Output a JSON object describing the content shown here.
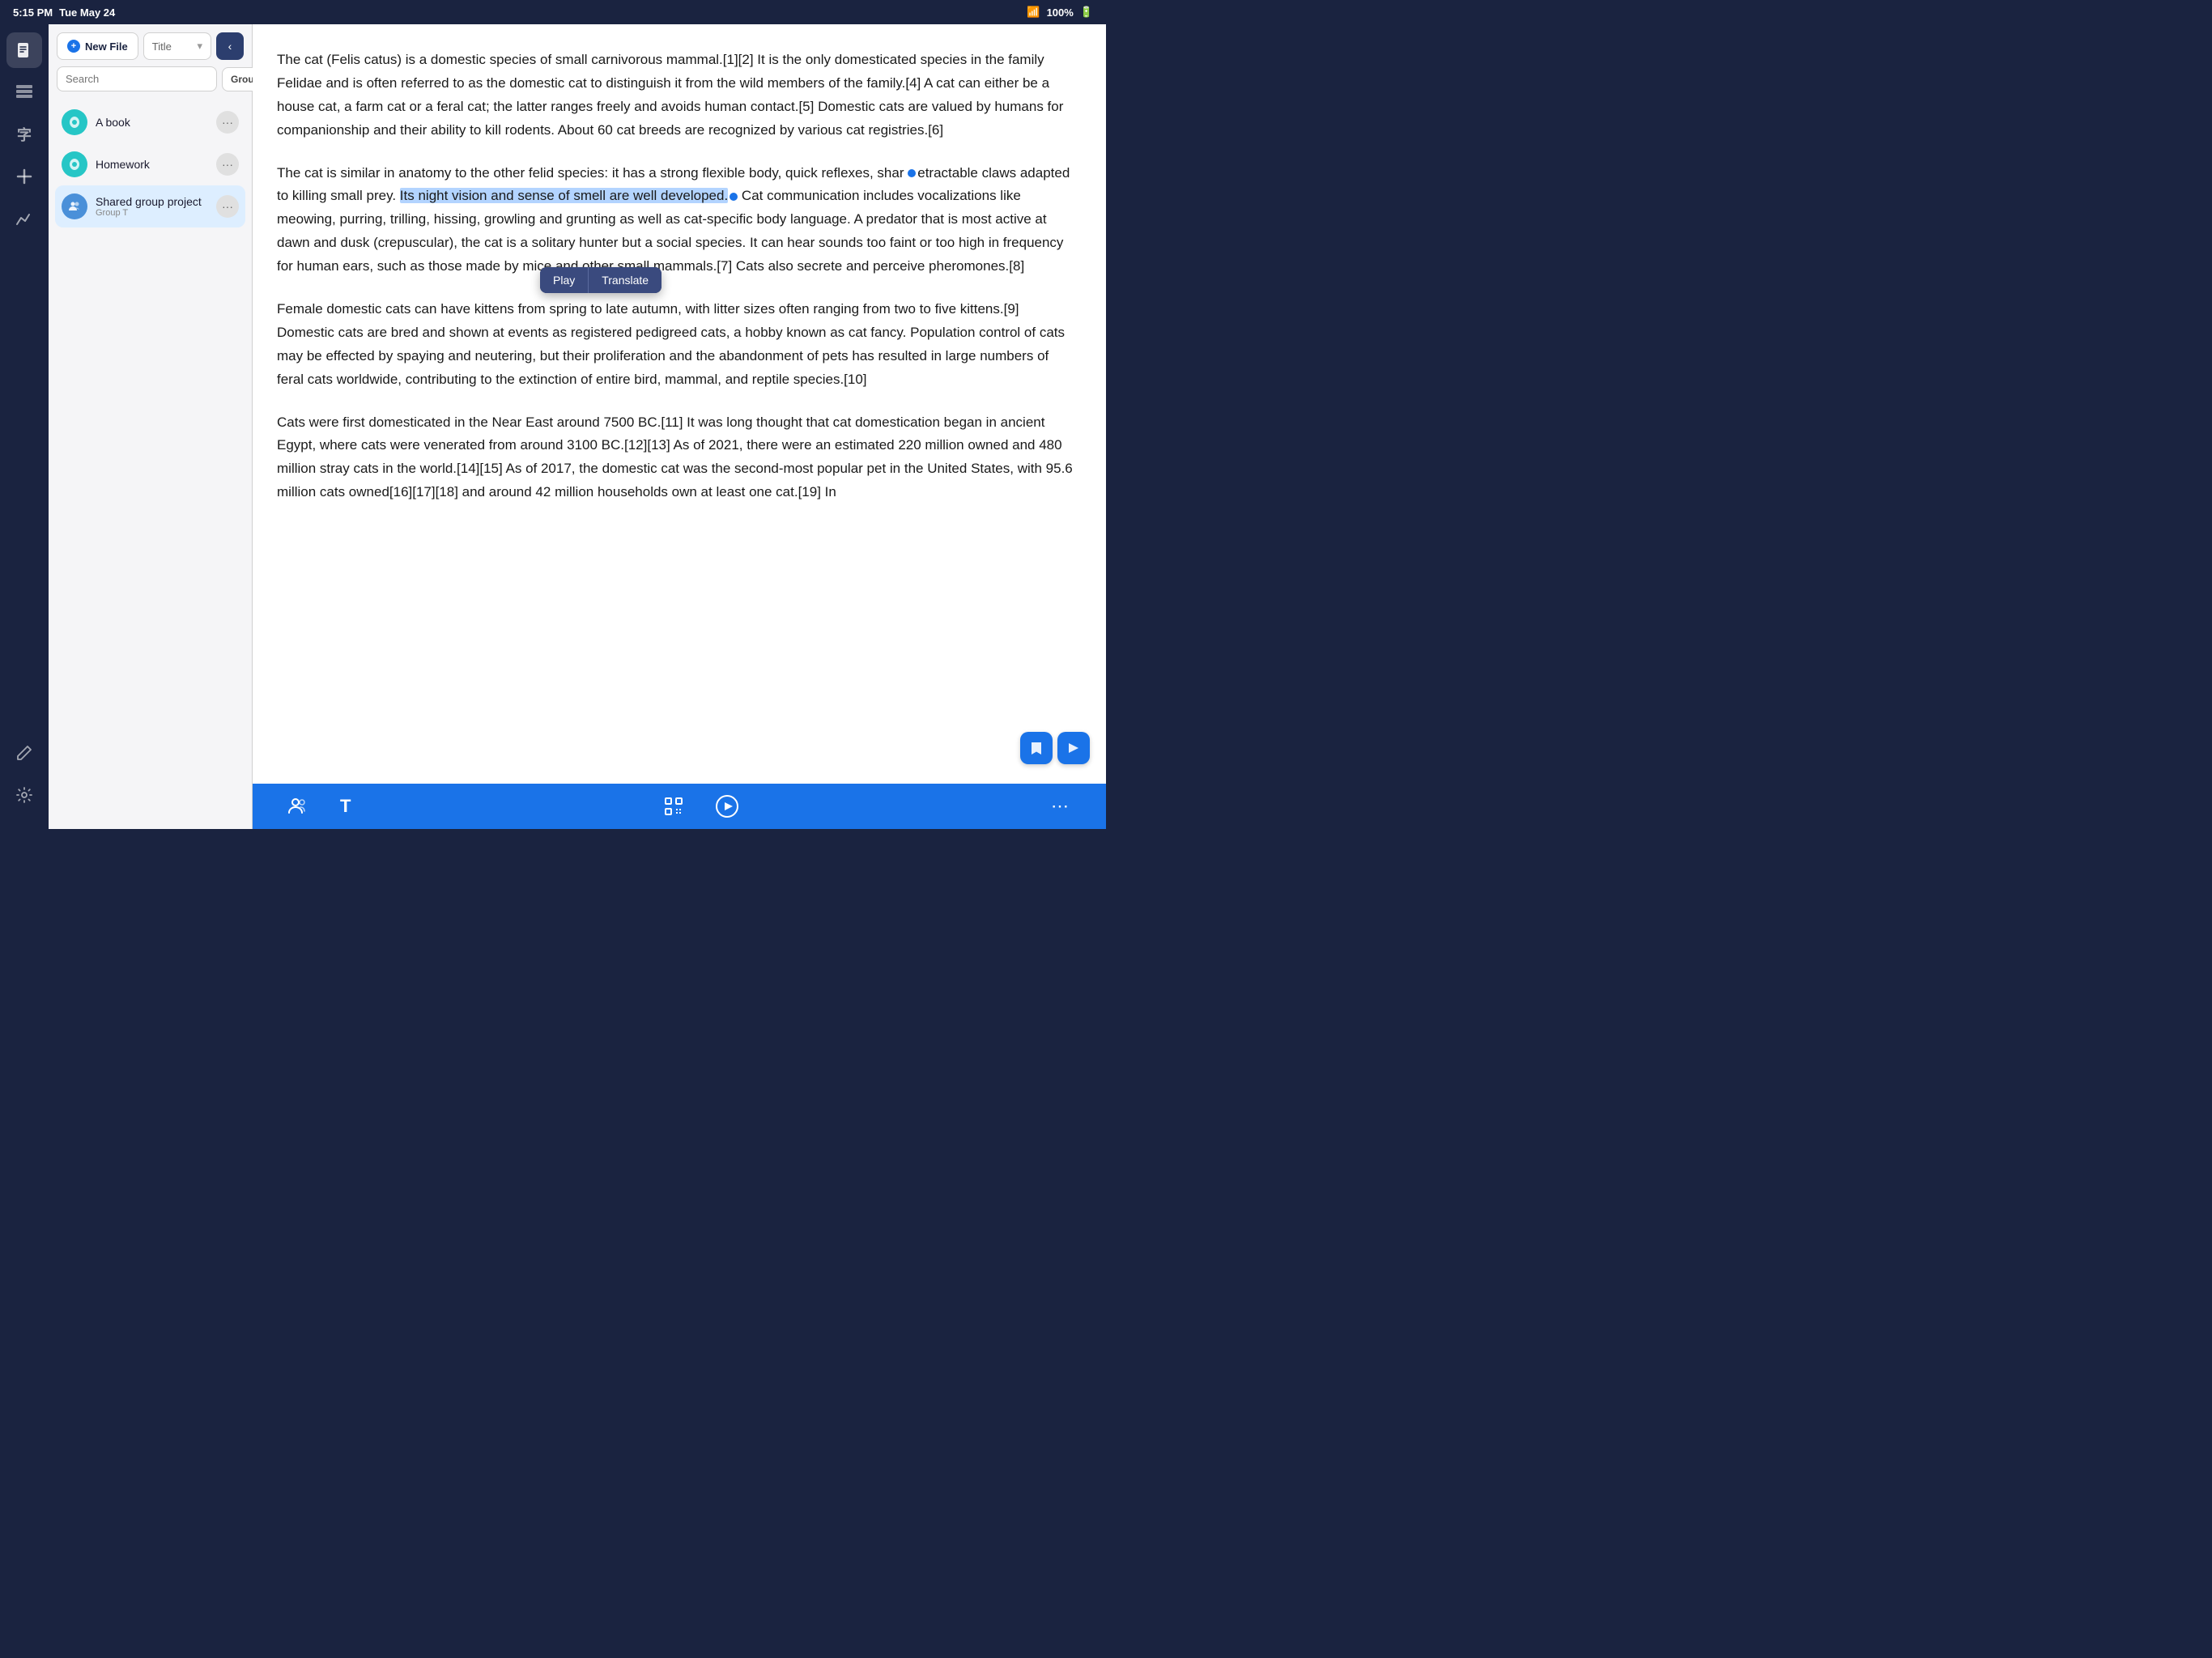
{
  "statusBar": {
    "time": "5:15 PM",
    "date": "Tue May 24",
    "battery": "100%",
    "wifi": "WiFi"
  },
  "nav": {
    "icons": [
      {
        "name": "document-icon",
        "symbol": "📄",
        "active": true
      },
      {
        "name": "bookmark-icon",
        "symbol": "🔖",
        "active": false
      },
      {
        "name": "translate-icon",
        "symbol": "字",
        "active": false
      },
      {
        "name": "add-icon",
        "symbol": "+",
        "active": false
      },
      {
        "name": "chart-icon",
        "symbol": "📈",
        "active": false
      }
    ],
    "bottomIcons": [
      {
        "name": "pen-icon",
        "symbol": "✏️"
      },
      {
        "name": "settings-icon",
        "symbol": "⚙️"
      }
    ]
  },
  "filePanel": {
    "newFileLabel": "New File",
    "titleDropdownLabel": "Title",
    "collapseIcon": "‹",
    "searchPlaceholder": "Search",
    "groupButtonLabel": "Group T",
    "files": [
      {
        "id": "a-book",
        "name": "A book",
        "iconType": "teal",
        "iconSymbol": "☁",
        "sub": null,
        "selected": false
      },
      {
        "id": "homework",
        "name": "Homework",
        "iconType": "teal",
        "iconSymbol": "☁",
        "sub": null,
        "selected": false
      },
      {
        "id": "shared-group-project",
        "name": "Shared group project",
        "iconType": "blue",
        "iconSymbol": "👥",
        "sub": "Group T",
        "selected": true
      }
    ]
  },
  "content": {
    "paragraphs": [
      "The cat (Felis catus) is a domestic species of small carnivorous mammal.[1][2] It is the only domesticated species in the family Felidae and is often referred to as the domestic cat to distinguish it from the wild members of the family.[4] A cat can either be a house cat, a farm cat or a feral cat; the latter ranges freely and avoids human contact.[5] Domestic cats are valued by humans for companionship and their ability to kill rodents. About 60 cat breeds are recognized by various cat registries.[6]",
      "The cat is similar in anatomy to the other felid species: it has a strong flexible body, quick reflexes, sharp retractable claws adapted to killing small prey. Its night vision and sense of smell are well developed. Cat communication includes vocalizations like meowing, purring, trilling, hissing, growling and grunting as well as cat-specific body language. A predator that is most active at dawn and dusk (crepuscular), the cat is a solitary hunter but a social species. It can hear sounds too faint or too high in frequency for human ears, such as those made by mice and other small mammals.[7] Cats also secrete and perceive pheromones.[8]",
      "Female domestic cats can have kittens from spring to late autumn, with litter sizes often ranging from two to five kittens.[9] Domestic cats are bred and shown at events as registered pedigreed cats, a hobby known as cat fancy. Population control of cats may be effected by spaying and neutering, but their proliferation and the abandonment of pets has resulted in large numbers of feral cats worldwide, contributing to the extinction of entire bird, mammal, and reptile species.[10]",
      "Cats were first domesticated in the Near East around 7500 BC.[11] It was long thought that cat domestication began in ancient Egypt, where cats were venerated from around 3100 BC.[12][13] As of 2021, there were an estimated 220 million owned and 480 million stray cats in the world.[14][15] As of 2017, the domestic cat was the second-most popular pet in the United States, with 95.6 million cats owned[16][17][18] and around 42 million households own at least one cat.[19] In"
    ],
    "selectedText": "Its night vision and sense of smell are well developed.",
    "popup": {
      "playLabel": "Play",
      "translateLabel": "Translate"
    }
  },
  "bottomToolbar": {
    "icons": [
      {
        "name": "users-icon",
        "symbol": "👥"
      },
      {
        "name": "text-icon",
        "symbol": "T"
      },
      {
        "name": "scan-icon",
        "symbol": "⊡"
      },
      {
        "name": "play-icon",
        "symbol": "▶"
      },
      {
        "name": "more-icon",
        "symbol": "⋯"
      }
    ]
  },
  "floatingBtns": [
    {
      "name": "bookmark-float-icon",
      "symbol": "🔖"
    },
    {
      "name": "forward-float-icon",
      "symbol": "▷"
    }
  ]
}
